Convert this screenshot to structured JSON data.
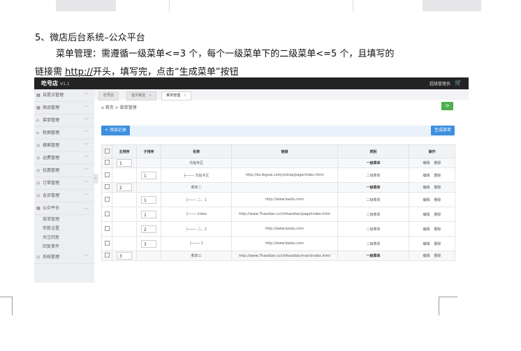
{
  "doc": {
    "heading": "5、微店后台系统–公众平台",
    "para_line1": "菜单管理：需遵循一级菜单<=3 个，每个一级菜单下的二级菜单<=5 个，且填写的",
    "para_line2_pre": "链接需 ",
    "para_line2_link": "http://",
    "para_line2_post": "开头，填写完，点击“生成菜单”按钮"
  },
  "app": {
    "brand": "吃号店",
    "version": "V1.1",
    "admin_label": "超级管理员",
    "cart_icon": "🛒"
  },
  "sidebar": {
    "items": [
      {
        "label": "自提点管理",
        "icon": "grid-icon"
      },
      {
        "label": "商品管理",
        "icon": "grid-icon"
      },
      {
        "label": "菜单管理",
        "icon": "home-icon"
      },
      {
        "label": "轮图管理",
        "icon": "home-icon"
      },
      {
        "label": "搜索管理",
        "icon": "circle-icon"
      },
      {
        "label": "运费管理",
        "icon": "circle-icon"
      },
      {
        "label": "优惠管理",
        "icon": "circle-icon"
      },
      {
        "label": "订单管理",
        "icon": "circle-icon"
      },
      {
        "label": "会员管理",
        "icon": "circle-icon"
      },
      {
        "label": "公众平台",
        "icon": "grid-icon"
      }
    ],
    "subitems": [
      "菜单管理",
      "参数设置",
      "关注回复",
      "回复事件"
    ],
    "last_item": {
      "label": "系统管理",
      "icon": "circle-icon"
    }
  },
  "tabs": [
    {
      "label": "吃号店"
    },
    {
      "label": "首页推送"
    },
    {
      "label": "菜单管理"
    }
  ],
  "breadcrumb": {
    "home": "首页",
    "sep": ">",
    "current": "菜单管理"
  },
  "toolbar": {
    "add_label": "+ 添加记录",
    "generate_label": "生成菜单"
  },
  "table": {
    "headers": [
      "",
      "主排序",
      "子排序",
      "名称",
      "链接",
      "类别",
      "操作"
    ],
    "actions": {
      "edit": "编辑",
      "delete": "删除"
    },
    "rows": [
      {
        "kind": "main",
        "main_order": "1",
        "sub_order": "",
        "name": "光临专区",
        "link": "",
        "type": "一级菜单"
      },
      {
        "kind": "sub",
        "main_order": "",
        "sub_order": "1",
        "name": "├──── 光临专区",
        "link": "http://dx.lbguai.com/yishop/page/index.html",
        "type": "二级菜单"
      },
      {
        "kind": "main",
        "main_order": "2",
        "sub_order": "",
        "name": "菜单二",
        "link": "",
        "type": "一级菜单"
      },
      {
        "kind": "sub",
        "main_order": "",
        "sub_order": "1",
        "name": "├──── 二、1",
        "link": "http://www.baidu.com",
        "type": "二级菜单"
      },
      {
        "kind": "sub",
        "main_order": "",
        "sub_order": "1",
        "name": "├──── index",
        "link": "http://www.7haodian.cc/chihaodian/page/index.html",
        "type": "二级菜单"
      },
      {
        "kind": "sub",
        "main_order": "",
        "sub_order": "2",
        "name": "├──── 二、2",
        "link": "http://www.baidu.com",
        "type": "二级菜单"
      },
      {
        "kind": "sub",
        "main_order": "",
        "sub_order": "3",
        "name": "├──── 2",
        "link": "http://www.baidu.com",
        "type": "二级菜单"
      },
      {
        "kind": "main",
        "main_order": "3",
        "sub_order": "",
        "name": "菜单三",
        "link": "http://www.7haodian.cc/chihaodian/main/index.html",
        "type": "一级菜单"
      }
    ]
  },
  "colors": {
    "topbar": "#232323",
    "primary": "#3d8fe0",
    "success": "#4cae4c",
    "sidebar": "#eceef1"
  }
}
